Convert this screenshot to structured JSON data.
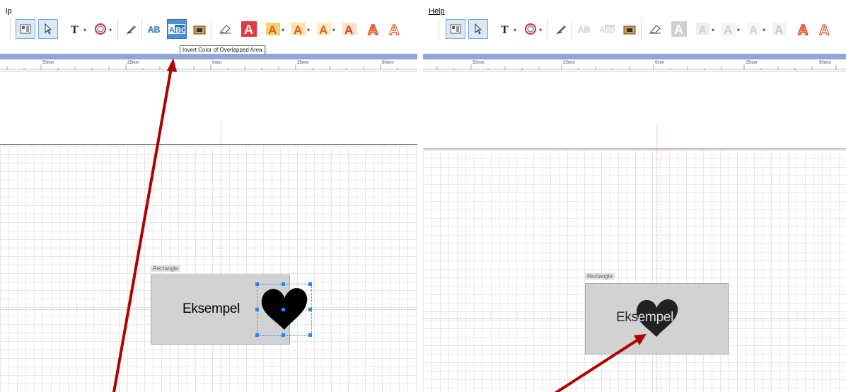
{
  "left_panel": {
    "menu_label": "lp",
    "tooltip": "Invert Color of Overlapped Area",
    "ruler_labels": [
      "50mm",
      "25mm",
      "0mm",
      "25mm",
      "50mm"
    ],
    "object_label": "Rectangle",
    "object_text": "Eksempel"
  },
  "right_panel": {
    "menu_label": "Help",
    "ruler_labels": [
      "50mm",
      "25mm",
      "0mm",
      "25mm",
      "50mm"
    ],
    "object_label": "Rectangle",
    "object_text": "Eksempel"
  },
  "toolbar_icons": [
    "layout-icon",
    "select-pointer-icon",
    "text-icon",
    "circle-icon",
    "pen-icon",
    "outline-text-icon",
    "invert-color-icon",
    "fill-bucket-icon",
    "eraser-icon",
    "red-a-icon",
    "orange-a-icon-1",
    "orange-a-icon-2",
    "orange-a-icon-3",
    "orange-a-icon-4",
    "outline-a-icon-1",
    "outline-a-icon-2"
  ],
  "colors": {
    "arrow": "#b00000",
    "handle": "#1e88ff",
    "rect_fill": "#d2d2d2",
    "blue_band": "#8fa7d8",
    "active_button": "#4a90d9"
  }
}
